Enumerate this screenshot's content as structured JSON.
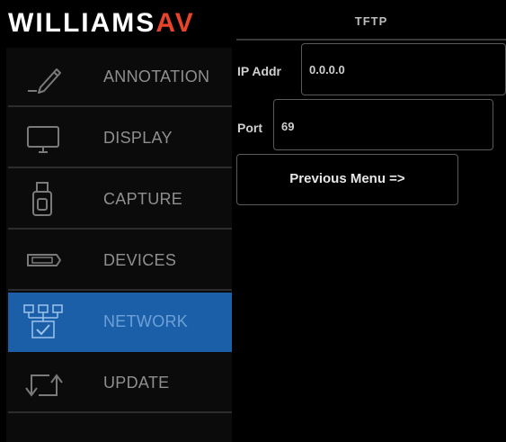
{
  "logo": {
    "text_left": "WILLIAMS",
    "text_accent": "AV"
  },
  "sidebar": {
    "items": [
      {
        "label": "ANNOTATION",
        "icon": "pen-icon",
        "active": false
      },
      {
        "label": "DISPLAY",
        "icon": "monitor-icon",
        "active": false
      },
      {
        "label": "CAPTURE",
        "icon": "usb-drive-icon",
        "active": false
      },
      {
        "label": "DEVICES",
        "icon": "serial-port-icon",
        "active": false
      },
      {
        "label": "NETWORK",
        "icon": "network-icon",
        "active": true
      },
      {
        "label": "UPDATE",
        "icon": "update-arrows-icon",
        "active": false
      }
    ]
  },
  "panel": {
    "title": "TFTP",
    "ip": {
      "label": "IP Addr",
      "value": "0.0.0.0"
    },
    "port": {
      "label": "Port",
      "value": "69"
    },
    "previous_menu_label": "Previous Menu =>"
  },
  "colors": {
    "background": "#000000",
    "active_nav": "#1a5fa8",
    "logo_accent": "#e8432b"
  }
}
